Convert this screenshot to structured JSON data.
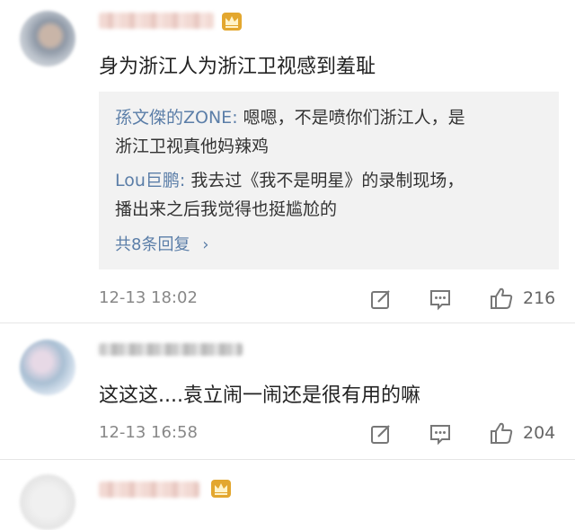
{
  "comments": [
    {
      "text": "身为浙江人为浙江卫视感到羞耻",
      "replies": [
        {
          "name": "孫文傑的ZONE:",
          "line1": " 嗯嗯，不是喷你们浙江人，是",
          "line2": "浙江卫视真他妈辣鸡"
        },
        {
          "name": "Lou巨鹏:",
          "line1": " 我去过《我不是明星》的录制现场，",
          "line2": "播出来之后我觉得也挺尴尬的"
        }
      ],
      "more_replies": "共8条回复",
      "more_chevron": "›",
      "time": "12-13 18:02",
      "likes": "216"
    },
    {
      "text": "这这这....袁立闹一闹还是很有用的嘛",
      "time": "12-13 16:58",
      "likes": "204"
    }
  ],
  "icons": {
    "crown": "crown-badge-icon",
    "repost": "repost-icon",
    "reply": "comment-icon",
    "like": "thumbs-up-icon"
  },
  "colors": {
    "link": "#5b7ea8",
    "reply_bg": "#f2f2f2",
    "meta": "#888888",
    "crown": "#e3a72f"
  }
}
